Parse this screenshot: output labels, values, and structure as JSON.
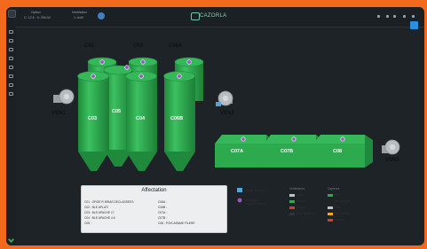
{
  "topbar": {
    "label_a": "Option",
    "value_a": "C: 12.5 · 0: 256.00",
    "label_b": "Ventilation",
    "value_b": "1: Actif",
    "brand": "CAZORLA"
  },
  "silos": {
    "C01": "C01",
    "C02": "C02",
    "C06A": "C06A",
    "C03": "C03",
    "C05": "C05",
    "C04": "C04",
    "C06B": "C06B"
  },
  "flat": {
    "C07A": "C07A",
    "C07B": "C07B",
    "C08": "C08"
  },
  "fans": {
    "ven1": "VEN1",
    "ven2": "VEN2",
    "ven3": "VEN3"
  },
  "colors": {
    "silo": "#2eaa4e",
    "silo_dark": "#1f8a3b",
    "sensor": "#9b59c8",
    "accent": "#f26a1b"
  },
  "affectation": {
    "title": "Affectation",
    "rows_left": [
      "C01 : ORGE R BIRAS DECLASSEES",
      "C02 : BLE APLATI",
      "C03 : BLE APACHE 17",
      "C04 : BLE APACHE 4.6",
      "C05 :"
    ],
    "rows_right": [
      "C06A :",
      "C06B :",
      "C07A :",
      "C07B :",
      "C08 : POIS ARAME FILERE"
    ]
  },
  "legend": {
    "mode_manual": "Mode manuel",
    "sensor_desc": "Présence capteur défaut",
    "ventilateurs_title": "Ventilateurs",
    "vent_items": [
      {
        "label": "Arrêt",
        "color": "#bfc4c8"
      },
      {
        "label": "Marche",
        "color": "#2eaa4e"
      },
      {
        "label": "Défaut",
        "color": "#d83a2e"
      },
      {
        "label": "Stop urgence",
        "color": "#333333"
      }
    ],
    "capteurs_title": "Capteurs",
    "capt_items": [
      {
        "label": "OK",
        "color": "#2eaa4e"
      },
      {
        "label": "Déconnecté",
        "color": "#222222"
      },
      {
        "label": "Vide",
        "color": "#bfc4c8"
      },
      {
        "label": "Pré-alarme",
        "color": "#f5a623"
      },
      {
        "label": "Alarme",
        "color": "#d83a2e"
      }
    ]
  }
}
